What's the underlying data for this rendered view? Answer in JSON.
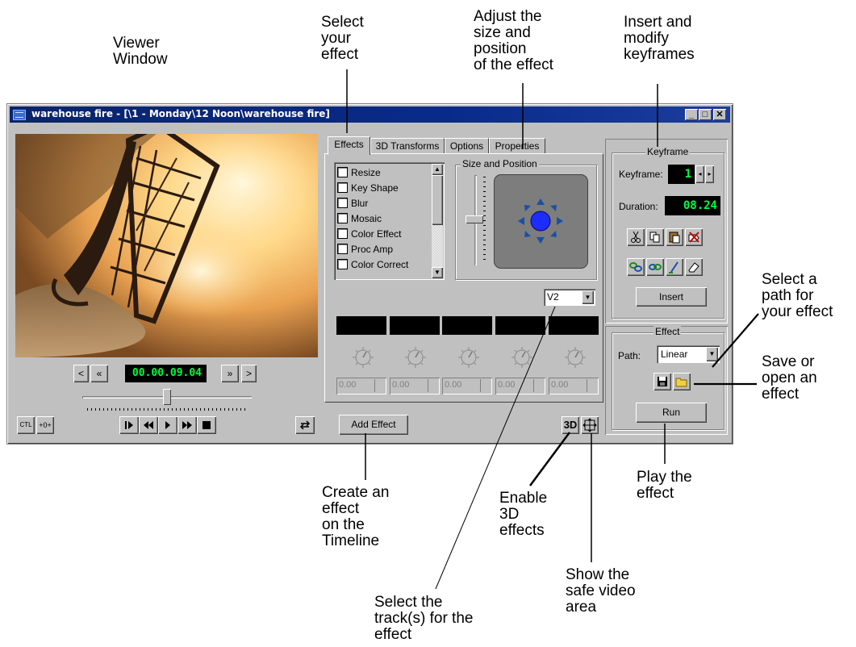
{
  "annotations": {
    "viewer_window": [
      "Viewer",
      "Window"
    ],
    "select_effect": [
      "Select",
      "your",
      "effect"
    ],
    "adjust_size": [
      "Adjust the",
      "size and",
      "position",
      "of the effect"
    ],
    "keyframes": [
      "Insert and",
      "modify",
      "keyframes"
    ],
    "select_path": [
      "Select a",
      "path for",
      "your effect"
    ],
    "save_open": [
      "Save or",
      "open an",
      "effect"
    ],
    "play_effect": [
      "Play the",
      "effect"
    ],
    "create_effect": [
      "Create an",
      "effect",
      "on the",
      "Timeline"
    ],
    "enable_3d": [
      "Enable",
      "3D",
      "effects"
    ],
    "safe_video": [
      "Show the",
      "safe video",
      "area"
    ],
    "select_track": [
      "Select the",
      "track(s) for the",
      "effect"
    ]
  },
  "window": {
    "title": "warehouse fire - [\\1 - Monday\\12 Noon\\warehouse fire]",
    "minimize": "_",
    "maximize": "□",
    "close": "✕"
  },
  "viewer": {
    "timecode": "00.00.09.04",
    "prev_frame": "<",
    "rewind": "«",
    "forward": "»",
    "next_frame": ">",
    "slider_position": 0.5,
    "ctl_label": "CTL",
    "offset_label": "+0+"
  },
  "tabs": [
    "Effects",
    "3D Transforms",
    "Options",
    "Properties"
  ],
  "effects_list": [
    "Resize",
    "Key Shape",
    "Blur",
    "Mosaic",
    "Color Effect",
    "Proc Amp",
    "Color Correct"
  ],
  "size_position": {
    "title": "Size and Position"
  },
  "track": {
    "selected": "V2"
  },
  "parameters": {
    "values": [
      "0.00",
      "0.00",
      "0.00",
      "0.00",
      "0.00"
    ]
  },
  "buttons": {
    "add_effect": "Add Effect",
    "three_d": "3D",
    "insert": "Insert",
    "run": "Run"
  },
  "keyframe": {
    "group_title": "Keyframe",
    "keyframe_label": "Keyframe:",
    "keyframe_value": "1",
    "duration_label": "Duration:",
    "duration_value": "08.24"
  },
  "effect_group": {
    "group_title": "Effect",
    "path_label": "Path:",
    "path_value": "Linear"
  },
  "colors": {
    "titlebar": "#0a246a",
    "lcd_text": "#00ff3c",
    "window": "#c0c0c0",
    "preview_panel": "#7d7d7d",
    "position_dot": "#1d2cff"
  }
}
